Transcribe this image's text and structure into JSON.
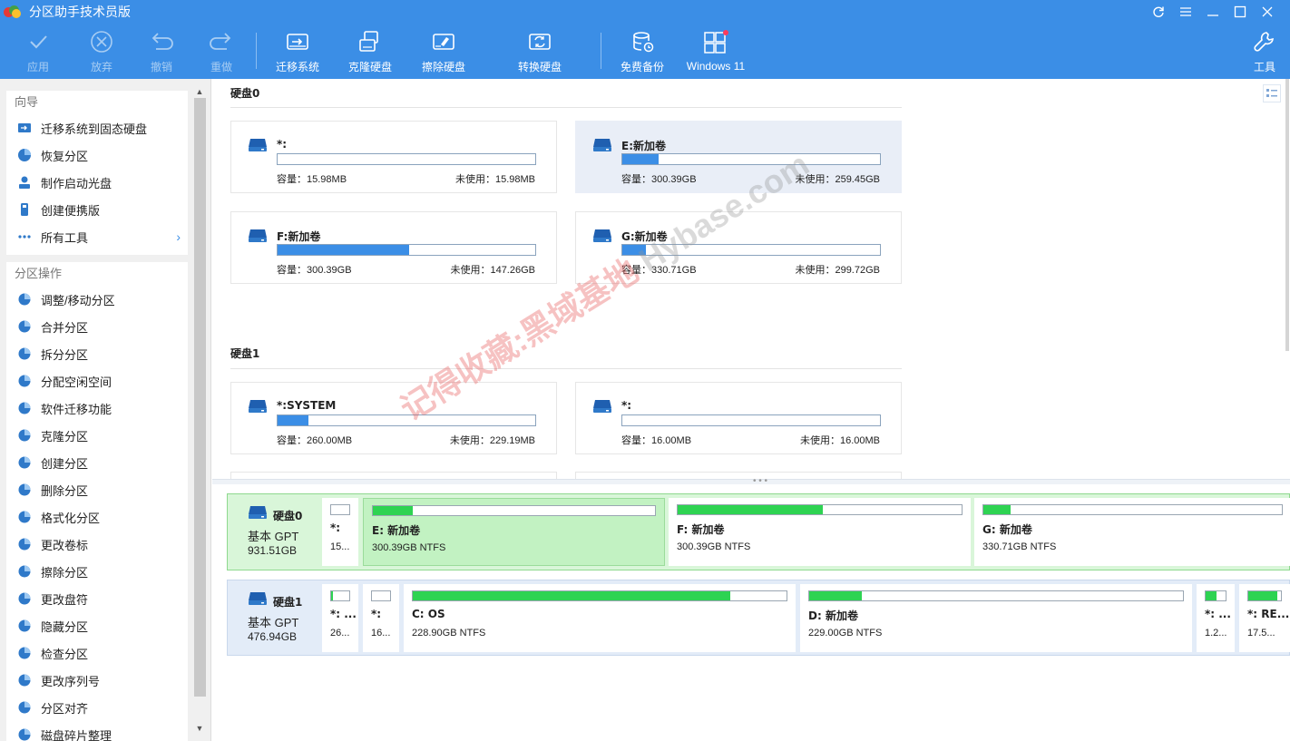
{
  "app": {
    "title": "分区助手技术员版"
  },
  "window_controls": [
    "refresh-icon",
    "menu-icon",
    "minimize-icon",
    "maximize-icon",
    "close-icon"
  ],
  "toolbar": {
    "apply": "应用",
    "discard": "放弃",
    "undo": "撤销",
    "redo": "重做",
    "migrate_os": "迁移系统",
    "clone_disk": "克隆硬盘",
    "wipe_disk": "擦除硬盘",
    "convert_disk": "转换硬盘",
    "free_backup": "免费备份",
    "windows11": "Windows 11",
    "tools": "工具"
  },
  "sidebar": {
    "wizard_header": "向导",
    "wizard_items": [
      {
        "label": "迁移系统到固态硬盘",
        "icon": "migrate-icon"
      },
      {
        "label": "恢复分区",
        "icon": "recover-icon"
      },
      {
        "label": "制作启动光盘",
        "icon": "boot-disk-icon"
      },
      {
        "label": "创建便携版",
        "icon": "portable-icon"
      },
      {
        "label": "所有工具",
        "icon": "more-icon"
      }
    ],
    "ops_header": "分区操作",
    "ops_items": [
      {
        "label": "调整/移动分区",
        "icon": "resize-icon"
      },
      {
        "label": "合并分区",
        "icon": "merge-icon"
      },
      {
        "label": "拆分分区",
        "icon": "split-icon"
      },
      {
        "label": "分配空闲空间",
        "icon": "allocate-icon"
      },
      {
        "label": "软件迁移功能",
        "icon": "app-move-icon"
      },
      {
        "label": "克隆分区",
        "icon": "clone-icon"
      },
      {
        "label": "创建分区",
        "icon": "create-icon"
      },
      {
        "label": "删除分区",
        "icon": "delete-icon"
      },
      {
        "label": "格式化分区",
        "icon": "format-icon"
      },
      {
        "label": "更改卷标",
        "icon": "label-icon"
      },
      {
        "label": "擦除分区",
        "icon": "wipe-icon"
      },
      {
        "label": "更改盘符",
        "icon": "letter-icon"
      },
      {
        "label": "隐藏分区",
        "icon": "hide-icon"
      },
      {
        "label": "检查分区",
        "icon": "check-icon"
      },
      {
        "label": "更改序列号",
        "icon": "serial-icon"
      },
      {
        "label": "分区对齐",
        "icon": "align-icon"
      },
      {
        "label": "磁盘碎片整理",
        "icon": "defrag-icon"
      }
    ]
  },
  "cards": {
    "disk0_title": "硬盘0",
    "disk1_title": "硬盘1",
    "disk0": [
      {
        "name": "*:",
        "cap": "容量：15.98MB",
        "free": "未使用：15.98MB",
        "used": 0.0
      },
      {
        "name": "E:新加卷",
        "cap": "容量：300.39GB",
        "free": "未使用：259.45GB",
        "used": 0.14
      },
      {
        "name": "F:新加卷",
        "cap": "容量：300.39GB",
        "free": "未使用：147.26GB",
        "used": 0.51
      },
      {
        "name": "G:新加卷",
        "cap": "容量：330.71GB",
        "free": "未使用：299.72GB",
        "used": 0.09
      }
    ],
    "disk1": [
      {
        "name": "*:SYSTEM",
        "cap": "容量：260.00MB",
        "free": "未使用：229.19MB",
        "used": 0.12
      },
      {
        "name": "*:",
        "cap": "容量：16.00MB",
        "free": "未使用：16.00MB",
        "used": 0.0
      }
    ]
  },
  "watermark": {
    "red": "记得收藏:黑域基地",
    "gray": "Hybase.com"
  },
  "disk_map": {
    "disk0": {
      "name": "硬盘0",
      "type": "基本 GPT",
      "size": "931.51GB"
    },
    "disk1": {
      "name": "硬盘1",
      "type": "基本 GPT",
      "size": "476.94GB"
    },
    "disk0_parts": [
      {
        "name": "*:",
        "info": "15...",
        "used": 0.0
      },
      {
        "name": "E: 新加卷",
        "info": "300.39GB NTFS",
        "used": 0.14
      },
      {
        "name": "F: 新加卷",
        "info": "300.39GB NTFS",
        "used": 0.51
      },
      {
        "name": "G: 新加卷",
        "info": "330.71GB NTFS",
        "used": 0.09
      }
    ],
    "disk1_parts": [
      {
        "name": "*: ...",
        "info": "26...",
        "used": 0.12
      },
      {
        "name": "*:",
        "info": "16...",
        "used": 0.0
      },
      {
        "name": "C: OS",
        "info": "228.90GB NTFS",
        "used": 0.85
      },
      {
        "name": "D: 新加卷",
        "info": "229.00GB NTFS",
        "used": 0.14
      },
      {
        "name": "*: ...",
        "info": "1.2...",
        "used": 0.55
      },
      {
        "name": "*: RE...",
        "info": "17.5...",
        "used": 0.9
      }
    ]
  },
  "colors": {
    "accent": "#3b8ee6",
    "used_green": "#2ed352",
    "selected_green": "#c2f2c2"
  }
}
